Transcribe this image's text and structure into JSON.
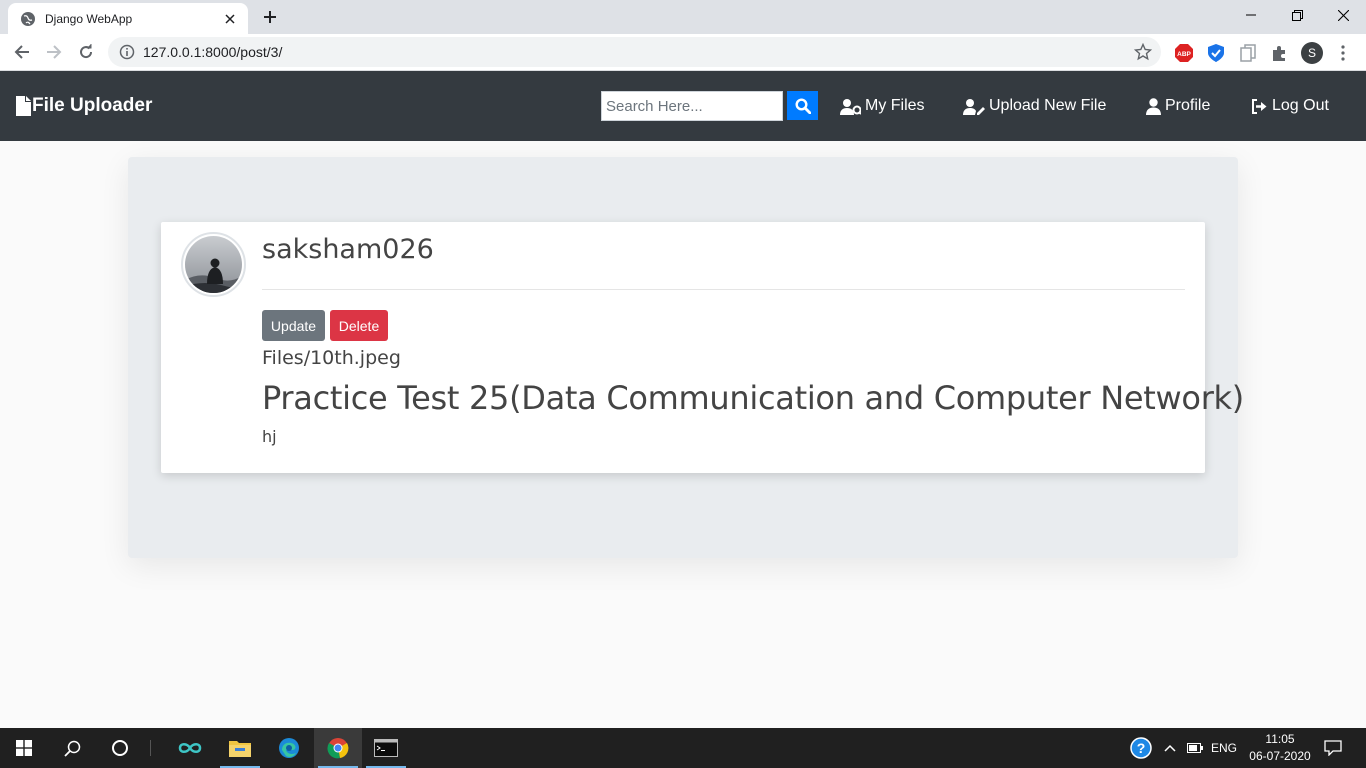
{
  "browser": {
    "tab_title": "Django WebApp",
    "url": "127.0.0.1:8000/post/3/",
    "profile_initial": "S",
    "abp_label": "ABP"
  },
  "navbar": {
    "brand": "File Uploader",
    "search_placeholder": "Search Here...",
    "links": [
      {
        "label": "My Files",
        "icon": "user-secret-icon"
      },
      {
        "label": "Upload New File",
        "icon": "user-edit-icon"
      },
      {
        "label": "Profile",
        "icon": "user-icon"
      },
      {
        "label": "Log Out",
        "icon": "sign-out-icon"
      }
    ]
  },
  "post": {
    "author": "saksham026",
    "update_label": "Update",
    "delete_label": "Delete",
    "file": "Files/10th.jpeg",
    "title": "Practice Test 25(Data Communication and Computer Network)",
    "content": "hj"
  },
  "taskbar": {
    "language": "ENG",
    "time": "11:05",
    "date": "06-07-2020"
  },
  "colors": {
    "navbar_bg": "#343a40",
    "search_button": "#007bff",
    "update_button": "#6c757d",
    "delete_button": "#dc3545",
    "jumbotron_bg": "#e9ecef"
  }
}
